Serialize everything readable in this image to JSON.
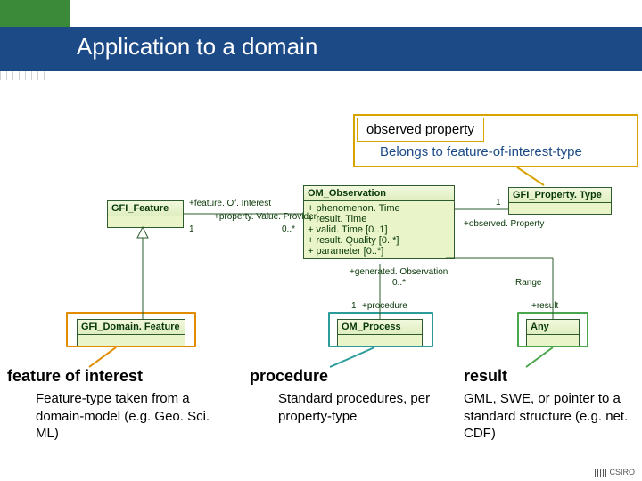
{
  "title": "Application to a domain",
  "top_callout": {
    "heading": "observed property",
    "sub": "Belongs to feature-of-interest-type"
  },
  "uml": {
    "gfi_feature": "GFI_Feature",
    "gfi_domain_feature": "GFI_Domain. Feature",
    "om_observation": {
      "name": "OM_Observation",
      "attrs": [
        "+   phenomenon. Time",
        "+   result. Time",
        "+   valid. Time [0..1]",
        "+   result. Quality [0..*]",
        "+   parameter [0..*]"
      ]
    },
    "gfi_property_type": "GFI_Property. Type",
    "om_process": "OM_Process",
    "any": "Any",
    "range_label": "Range",
    "assoc": {
      "feature_of_interest": "+feature. Of. Interest",
      "property_value_provider": "+property. Value. Provider",
      "mult_1_left": "1",
      "mult_0s_left": "0..*",
      "observed_property": "+observed. Property",
      "mult_1_right": "1",
      "generated_observation": "+generated. Observation",
      "mult_0s_down": "0..*",
      "procedure": "+procedure",
      "mult_1_proc": "1",
      "result": "+result"
    }
  },
  "annotations": {
    "foi": {
      "head": "feature of interest",
      "body": "Feature-type taken from a domain-model (e.g. Geo. Sci. ML)"
    },
    "proc": {
      "head": "procedure",
      "body": "Standard procedures, per property-type"
    },
    "res": {
      "head": "result",
      "body": "GML, SWE, or pointer to a standard structure (e.g. net. CDF)"
    }
  },
  "logo": "CSIRO"
}
